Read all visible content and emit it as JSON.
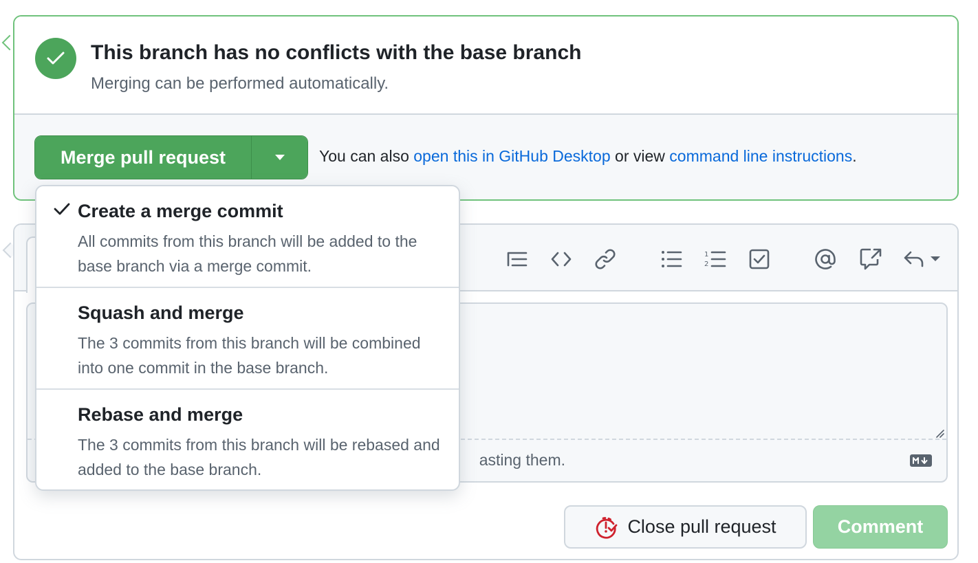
{
  "merge_status": {
    "title": "This branch has no conflicts with the base branch",
    "subtitle": "Merging can be performed automatically."
  },
  "merge_actions": {
    "merge_button_label": "Merge pull request",
    "also_prefix": "You can also ",
    "desktop_link": "open this in GitHub Desktop",
    "or_view": " or view ",
    "cli_link": "command line instructions",
    "suffix": "."
  },
  "merge_menu": {
    "items": [
      {
        "title": "Create a merge commit",
        "description": "All commits from this branch will be added to the base branch via a merge commit.",
        "selected": true
      },
      {
        "title": "Squash and merge",
        "description": "The 3 commits from this branch will be combined into one commit in the base branch.",
        "selected": false
      },
      {
        "title": "Rebase and merge",
        "description": "The 3 commits from this branch will be rebased and added to the base branch.",
        "selected": false
      }
    ]
  },
  "comment_box": {
    "toolbar_icons": [
      "heading-icon",
      "code-icon",
      "link-icon",
      "unordered-list-icon",
      "ordered-list-icon",
      "task-list-icon",
      "mention-icon",
      "reference-icon",
      "reply-icon"
    ],
    "paste_hint_visible": "asting them.",
    "close_pr_label": "Close pull request",
    "comment_label": "Comment"
  },
  "colors": {
    "success_green": "#4ca55b",
    "link_blue": "#0969da",
    "danger_red": "#cf222e",
    "comment_disabled": "#94d3a2"
  }
}
